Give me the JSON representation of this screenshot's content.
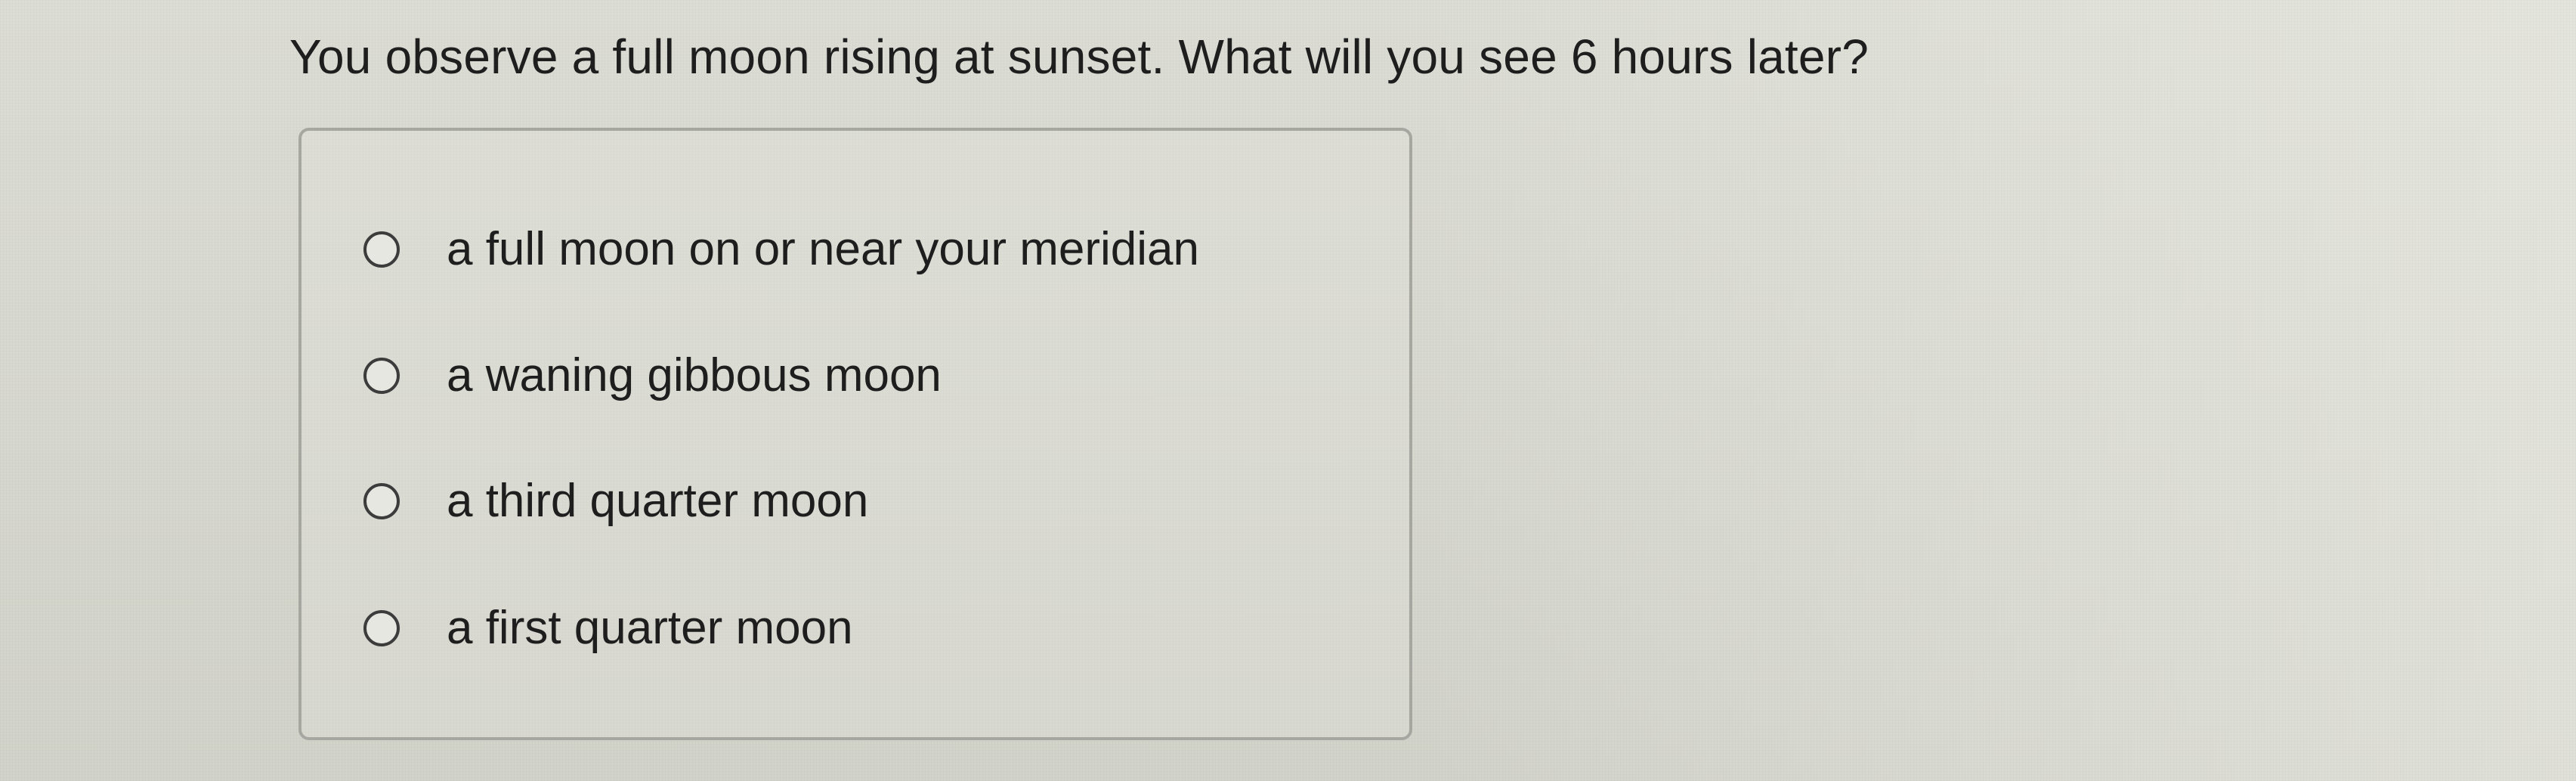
{
  "question": {
    "text": "You observe a full moon rising at sunset. What will you see 6 hours later?"
  },
  "options": [
    {
      "label": "a full moon on or near your meridian",
      "selected": false,
      "icon": "radio-circle"
    },
    {
      "label": "a waning gibbous moon",
      "selected": false,
      "icon": "radio-circle"
    },
    {
      "label": "a third quarter moon",
      "selected": false,
      "icon": "radio-circle"
    },
    {
      "label": "a first quarter moon",
      "selected": false,
      "icon": "radio-circle"
    }
  ],
  "colors": {
    "background": "#d9dad1",
    "text": "#1e1e1e",
    "border": "#a7a7a2",
    "radio_border": "#3c3c3c"
  }
}
